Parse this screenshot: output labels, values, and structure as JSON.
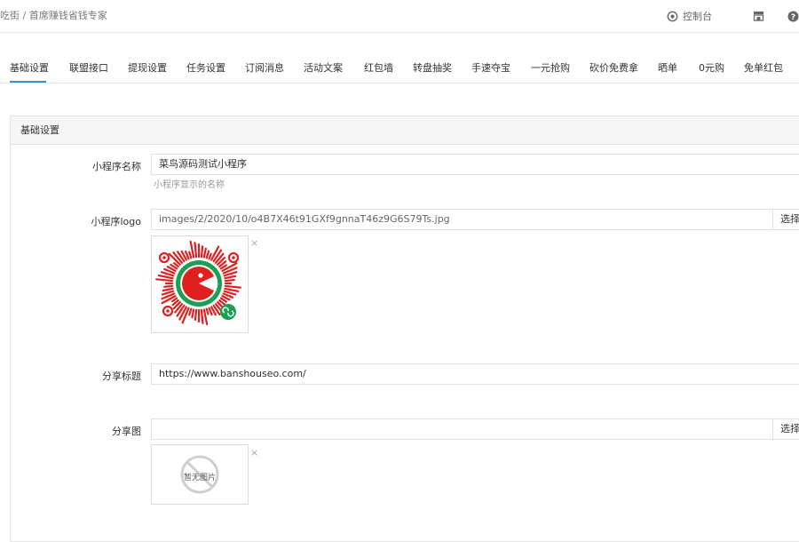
{
  "header": {
    "breadcrumb": "吃街 / 首席赚钱省钱专家",
    "console_label": "控制台",
    "icons": [
      "console-icon",
      "store-icon",
      "help-icon"
    ]
  },
  "tabs": [
    {
      "label": "基础设置",
      "active": true
    },
    {
      "label": "联盟接口",
      "active": false
    },
    {
      "label": "提现设置",
      "active": false
    },
    {
      "label": "任务设置",
      "active": false
    },
    {
      "label": "订阅消息",
      "active": false
    },
    {
      "label": "活动文案",
      "active": false
    },
    {
      "label": "红包墙",
      "active": false
    },
    {
      "label": "转盘抽奖",
      "active": false
    },
    {
      "label": "手速夺宝",
      "active": false
    },
    {
      "label": "一元抢购",
      "active": false
    },
    {
      "label": "砍价免费拿",
      "active": false
    },
    {
      "label": "晒单",
      "active": false
    },
    {
      "label": "0元购",
      "active": false
    },
    {
      "label": "免单红包",
      "active": false
    }
  ],
  "panel": {
    "title": "基础设置",
    "fields": {
      "app_name": {
        "label": "小程序名称",
        "value": "菜鸟源码测试小程序",
        "help": "小程序显示的名称"
      },
      "app_logo": {
        "label": "小程序logo",
        "value": "images/2/2020/10/o4B7X46t91GXf9gnnaT46z9G6S79Ts.jpg",
        "select_label": "选择",
        "remove_label": "×"
      },
      "share_title": {
        "label": "分享标题",
        "value": "https://www.banshouseo.com/"
      },
      "share_image": {
        "label": "分享图",
        "value": "",
        "select_label": "选择",
        "remove_label": "×",
        "no_image_text": "暂无图片"
      }
    }
  },
  "colors": {
    "accent": "#3b8fd8",
    "logo_red": "#e02020",
    "logo_green": "#1aa053"
  }
}
